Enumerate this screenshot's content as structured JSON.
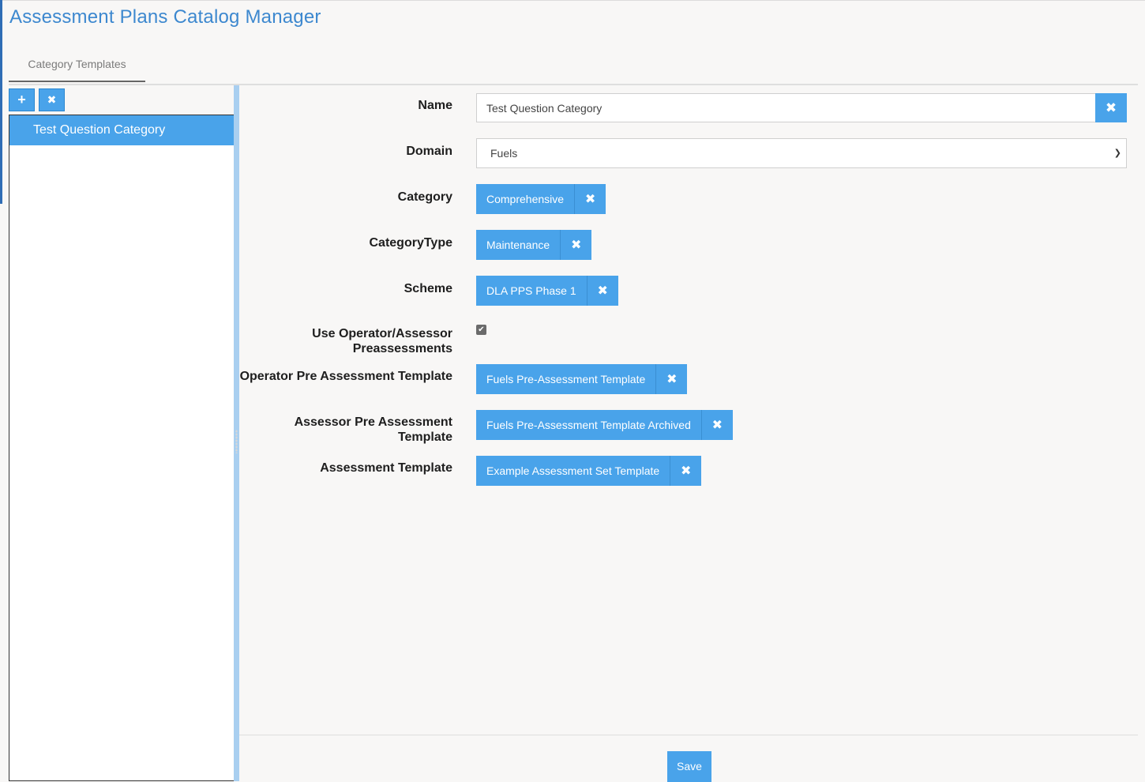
{
  "app": {
    "title": "Assessment Plans Catalog Manager"
  },
  "tabs": [
    {
      "label": "Category Templates",
      "active": true
    }
  ],
  "list": {
    "toolbar": {
      "add_icon": "plus-icon",
      "remove_icon": "close-icon"
    },
    "items": [
      {
        "label": "Test Question Category",
        "selected": true
      }
    ]
  },
  "form": {
    "name": {
      "label": "Name",
      "value": "Test Question Category"
    },
    "domain": {
      "label": "Domain",
      "value": "Fuels"
    },
    "category": {
      "label": "Category",
      "value": "Comprehensive"
    },
    "category_type": {
      "label": "CategoryType",
      "value": "Maintenance"
    },
    "scheme": {
      "label": "Scheme",
      "value": "DLA PPS Phase 1"
    },
    "use_preassessments": {
      "label": "Use Operator/Assessor Preassessments",
      "checked": true
    },
    "operator_pre_template": {
      "label": "Operator Pre Assessment Template",
      "value": "Fuels Pre-Assessment Template"
    },
    "assessor_pre_template": {
      "label": "Assessor Pre Assessment Template",
      "value": "Fuels Pre-Assessment Template Archived"
    },
    "assessment_template": {
      "label": "Assessment Template",
      "value": "Example Assessment Set Template"
    }
  },
  "footer": {
    "save_label": "Save"
  },
  "colors": {
    "accent": "#49a3ea",
    "title": "#3d88cf",
    "background": "#f8f7f6"
  }
}
